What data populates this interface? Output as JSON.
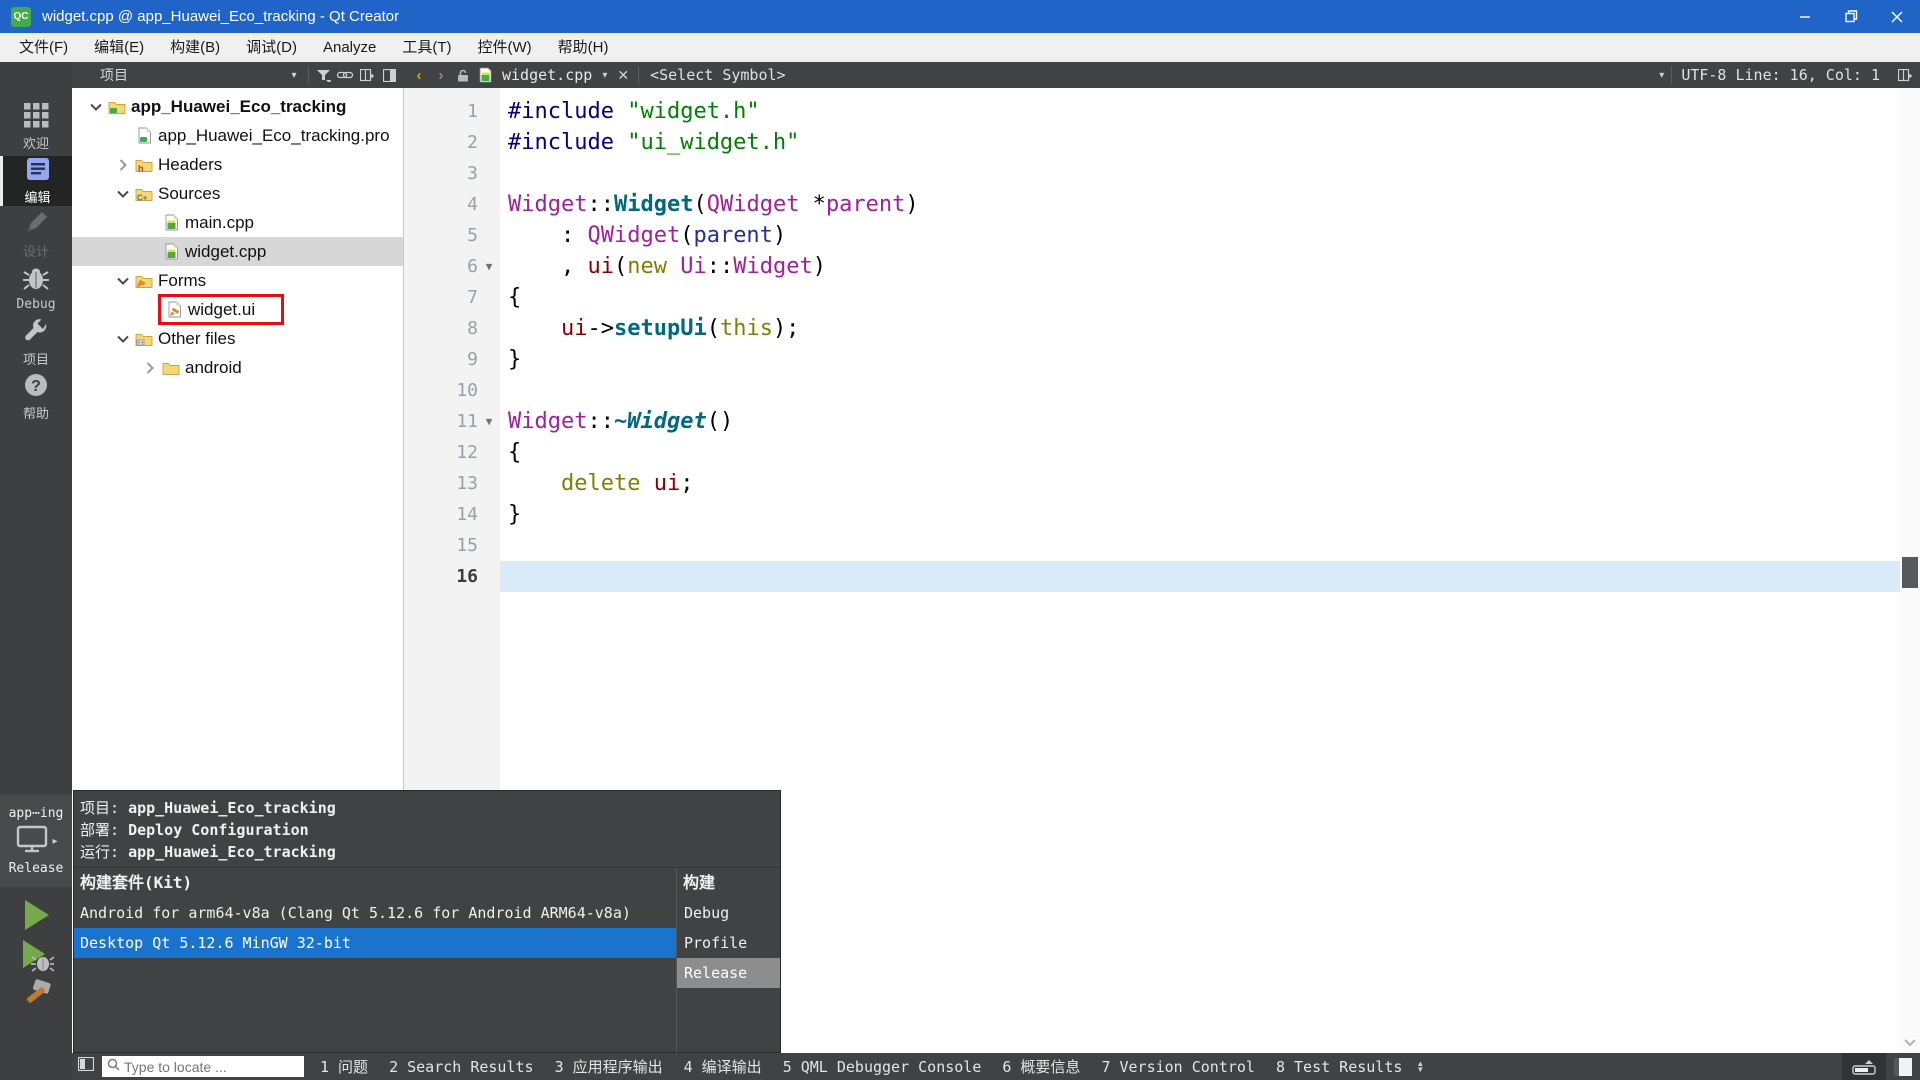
{
  "colors": {
    "titlebar": "#2164c8",
    "chrome_dark": "#404244",
    "kit_selected_blue": "#1a74ce",
    "release_highlight": "#8d8d8d",
    "current_line": "#d9ebf9",
    "tree_selection": "#d7d7d7",
    "annotation_red": "#e3100f",
    "qt_green": "#3fae49",
    "run_green": "#74a94c"
  },
  "title_bar": {
    "logo": "QC",
    "title": "widget.cpp @ app_Huawei_Eco_tracking - Qt Creator"
  },
  "menu_bar": {
    "items": [
      "文件(F)",
      "编辑(E)",
      "构建(B)",
      "调试(D)",
      "Analyze",
      "工具(T)",
      "控件(W)",
      "帮助(H)"
    ]
  },
  "toolbar": {
    "panel_title": "项目",
    "open_file": "widget.cpp",
    "symbol_selector": "<Select Symbol>",
    "encoding_status": "UTF-8 Line: 16, Col: 1"
  },
  "sidebar": {
    "modes": [
      {
        "label": "欢迎",
        "icon": "welcome-grid-icon"
      },
      {
        "label": "编辑",
        "icon": "edit-document-icon",
        "active": true
      },
      {
        "label": "设计",
        "icon": "design-pencil-icon",
        "disabled": true
      },
      {
        "label": "Debug",
        "icon": "debug-bug-icon"
      },
      {
        "label": "项目",
        "icon": "projects-wrench-icon"
      },
      {
        "label": "帮助",
        "icon": "help-question-icon"
      }
    ],
    "kit_selector": {
      "project_short": "app⋯ing",
      "build_config": "Release",
      "icon": "monitor-icon"
    },
    "run_buttons": [
      {
        "name": "run-button",
        "icon": "play-icon"
      },
      {
        "name": "debug-run-button",
        "icon": "play-bug-icon"
      },
      {
        "name": "build-button",
        "icon": "hammer-icon"
      }
    ]
  },
  "project_tree": {
    "items": [
      {
        "label": "app_Huawei_Eco_tracking",
        "level": 0,
        "caret": "down",
        "icon": "folder-qt-icon",
        "bold": true
      },
      {
        "label": "app_Huawei_Eco_tracking.pro",
        "level": 1,
        "caret": "none",
        "icon": "file-qt-icon"
      },
      {
        "label": "Headers",
        "level": 1,
        "caret": "right",
        "icon": "folder-headers-icon"
      },
      {
        "label": "Sources",
        "level": 1,
        "caret": "down",
        "icon": "folder-sources-icon"
      },
      {
        "label": "main.cpp",
        "level": 2,
        "caret": "none",
        "icon": "file-cpp-icon"
      },
      {
        "label": "widget.cpp",
        "level": 2,
        "caret": "none",
        "icon": "file-cpp-icon",
        "selected": true
      },
      {
        "label": "Forms",
        "level": 1,
        "caret": "down",
        "icon": "folder-forms-icon"
      },
      {
        "label": "widget.ui",
        "level": 2,
        "caret": "none",
        "icon": "file-ui-icon",
        "annotated": true
      },
      {
        "label": "Other files",
        "level": 1,
        "caret": "down",
        "icon": "folder-other-icon"
      },
      {
        "label": "android",
        "level": 2,
        "caret": "right",
        "icon": "folder-plain-icon"
      }
    ]
  },
  "editor": {
    "current_line": 16,
    "lines": [
      {
        "num": 1,
        "tokens": [
          [
            "pre",
            "#include"
          ],
          [
            "plain",
            " "
          ],
          [
            "str",
            "\"widget.h\""
          ]
        ]
      },
      {
        "num": 2,
        "tokens": [
          [
            "pre",
            "#include"
          ],
          [
            "plain",
            " "
          ],
          [
            "str",
            "\"ui_widget.h\""
          ]
        ]
      },
      {
        "num": 3,
        "tokens": []
      },
      {
        "num": 4,
        "tokens": [
          [
            "type",
            "Widget"
          ],
          [
            "plain",
            "::"
          ],
          [
            "fn",
            "Widget"
          ],
          [
            "plain",
            "("
          ],
          [
            "type",
            "QWidget"
          ],
          [
            "plain",
            " *"
          ],
          [
            "type",
            "parent"
          ],
          [
            "plain",
            ")"
          ]
        ]
      },
      {
        "num": 5,
        "tokens": [
          [
            "plain",
            "    : "
          ],
          [
            "type",
            "QWidget"
          ],
          [
            "plain",
            "("
          ],
          [
            "loc",
            "parent"
          ],
          [
            "plain",
            ")"
          ]
        ]
      },
      {
        "num": 6,
        "fold": true,
        "tokens": [
          [
            "plain",
            "    , "
          ],
          [
            "field",
            "ui"
          ],
          [
            "plain",
            "("
          ],
          [
            "kw",
            "new"
          ],
          [
            "plain",
            " "
          ],
          [
            "type",
            "Ui"
          ],
          [
            "plain",
            "::"
          ],
          [
            "type",
            "Widget"
          ],
          [
            "plain",
            ")"
          ]
        ]
      },
      {
        "num": 7,
        "tokens": [
          [
            "plain",
            "{"
          ]
        ]
      },
      {
        "num": 8,
        "tokens": [
          [
            "plain",
            "    "
          ],
          [
            "field",
            "ui"
          ],
          [
            "plain",
            "->"
          ],
          [
            "fn",
            "setupUi"
          ],
          [
            "plain",
            "("
          ],
          [
            "kw",
            "this"
          ],
          [
            "plain",
            ");"
          ]
        ]
      },
      {
        "num": 9,
        "tokens": [
          [
            "plain",
            "}"
          ]
        ]
      },
      {
        "num": 10,
        "tokens": []
      },
      {
        "num": 11,
        "fold": true,
        "tokens": [
          [
            "type",
            "Widget"
          ],
          [
            "plain",
            "::"
          ],
          [
            "fnit",
            "~Widget"
          ],
          [
            "plain",
            "()"
          ]
        ]
      },
      {
        "num": 12,
        "tokens": [
          [
            "plain",
            "{"
          ]
        ]
      },
      {
        "num": 13,
        "tokens": [
          [
            "plain",
            "    "
          ],
          [
            "kw",
            "delete"
          ],
          [
            "plain",
            " "
          ],
          [
            "field",
            "ui"
          ],
          [
            "plain",
            ";"
          ]
        ]
      },
      {
        "num": 14,
        "tokens": [
          [
            "plain",
            "}"
          ]
        ]
      },
      {
        "num": 15,
        "tokens": []
      },
      {
        "num": 16,
        "tokens": []
      }
    ]
  },
  "kit_popup": {
    "project_label": "项目:",
    "project_value": "app_Huawei_Eco_tracking",
    "deploy_label": "部署:",
    "deploy_value": "Deploy Configuration",
    "run_label": "运行:",
    "run_value": "app_Huawei_Eco_tracking",
    "kit_header": "构建套件(Kit)",
    "build_header": "构建",
    "kits": [
      {
        "label": "Android for arm64-v8a (Clang Qt 5.12.6 for Android ARM64-v8a)"
      },
      {
        "label": "Desktop Qt 5.12.6 MinGW 32-bit",
        "selected": true
      }
    ],
    "build_configs": [
      {
        "label": "Debug"
      },
      {
        "label": "Profile"
      },
      {
        "label": "Release",
        "highlighted": true
      }
    ]
  },
  "status_bar": {
    "locator_placeholder": "Type to locate ...",
    "panes": [
      "1 问题",
      "2 Search Results",
      "3 应用程序输出",
      "4 编译输出",
      "5 QML Debugger Console",
      "6 概要信息",
      "7 Version Control",
      "8 Test Results"
    ]
  }
}
